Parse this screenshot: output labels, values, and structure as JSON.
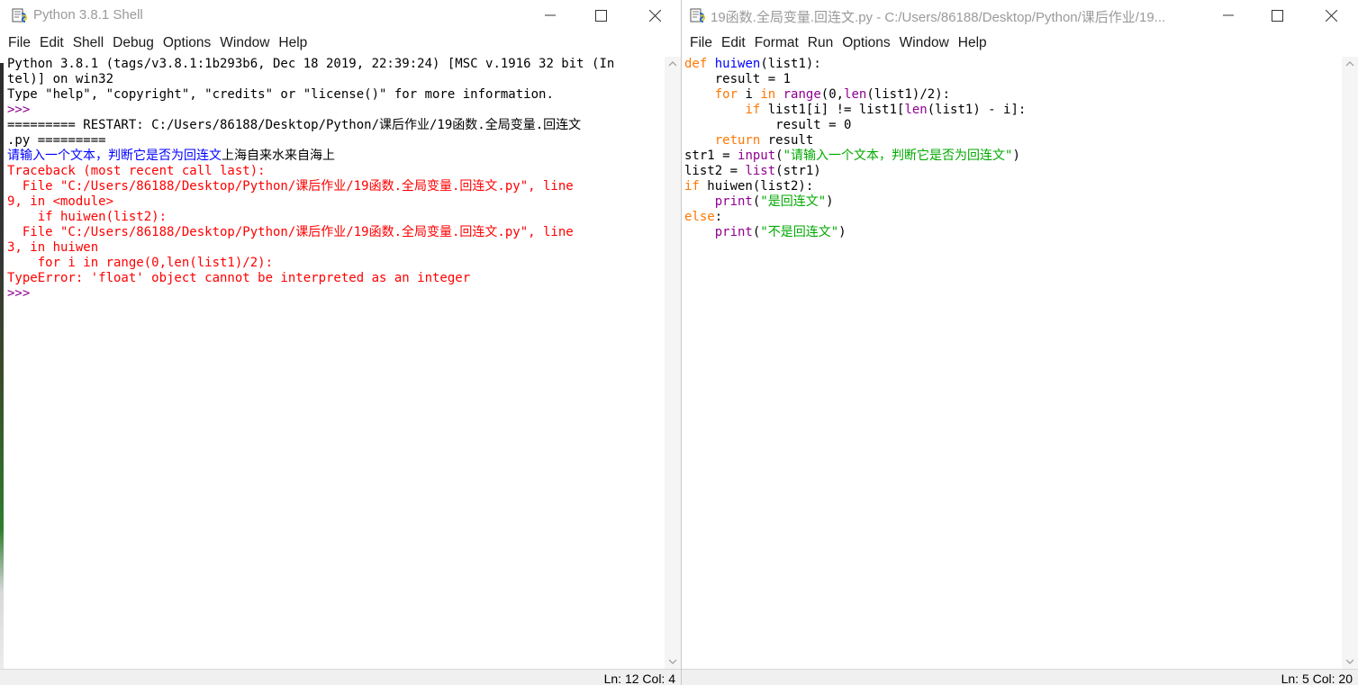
{
  "shell": {
    "title": "Python 3.8.1 Shell",
    "menu": [
      "File",
      "Edit",
      "Shell",
      "Debug",
      "Options",
      "Window",
      "Help"
    ],
    "lines": [
      {
        "segments": [
          {
            "text": "Python 3.8.1 (tags/v3.8.1:1b293b6, Dec 18 2019, 22:39:24) [MSC v.1916 32 bit (In",
            "color": "black"
          }
        ]
      },
      {
        "segments": [
          {
            "text": "tel)] on win32",
            "color": "black"
          }
        ]
      },
      {
        "segments": [
          {
            "text": "Type \"help\", \"copyright\", \"credits\" or \"license()\" for more information.",
            "color": "black"
          }
        ]
      },
      {
        "segments": [
          {
            "text": ">>> ",
            "color": "purple"
          }
        ]
      },
      {
        "segments": [
          {
            "text": "========= RESTART: C:/Users/86188/Desktop/Python/课后作业/19函数.全局变量.回连文",
            "color": "black"
          }
        ]
      },
      {
        "segments": [
          {
            "text": ".py =========",
            "color": "black"
          }
        ]
      },
      {
        "segments": [
          {
            "text": "请输入一个文本，判断它是否为回连文",
            "color": "blue"
          },
          {
            "text": "上海自来水来自海上",
            "color": "black"
          }
        ]
      },
      {
        "segments": [
          {
            "text": "Traceback (most recent call last):",
            "color": "red"
          }
        ]
      },
      {
        "segments": [
          {
            "text": "  File \"C:/Users/86188/Desktop/Python/课后作业/19函数.全局变量.回连文.py\", line",
            "color": "red"
          }
        ]
      },
      {
        "segments": [
          {
            "text": "9, in <module>",
            "color": "red"
          }
        ]
      },
      {
        "segments": [
          {
            "text": "    if huiwen(list2):",
            "color": "red"
          }
        ]
      },
      {
        "segments": [
          {
            "text": "  File \"C:/Users/86188/Desktop/Python/课后作业/19函数.全局变量.回连文.py\", line",
            "color": "red"
          }
        ]
      },
      {
        "segments": [
          {
            "text": "3, in huiwen",
            "color": "red"
          }
        ]
      },
      {
        "segments": [
          {
            "text": "    for i in range(0,len(list1)/2):",
            "color": "red"
          }
        ]
      },
      {
        "segments": [
          {
            "text": "TypeError: 'float' object cannot be interpreted as an integer",
            "color": "red"
          }
        ]
      },
      {
        "segments": [
          {
            "text": ">>> ",
            "color": "purple"
          }
        ]
      }
    ],
    "status": "Ln: 12  Col: 4"
  },
  "editor": {
    "title": "19函数.全局变量.回连文.py - C:/Users/86188/Desktop/Python/课后作业/19...",
    "menu": [
      "File",
      "Edit",
      "Format",
      "Run",
      "Options",
      "Window",
      "Help"
    ],
    "lines": [
      {
        "segments": [
          {
            "text": "def",
            "color": "orange"
          },
          {
            "text": " ",
            "color": "black"
          },
          {
            "text": "huiwen",
            "color": "blue"
          },
          {
            "text": "(list1):",
            "color": "black"
          }
        ]
      },
      {
        "segments": [
          {
            "text": "    result = 1",
            "color": "black"
          }
        ]
      },
      {
        "segments": [
          {
            "text": "    ",
            "color": "black"
          },
          {
            "text": "for",
            "color": "orange"
          },
          {
            "text": " i ",
            "color": "black"
          },
          {
            "text": "in",
            "color": "orange"
          },
          {
            "text": " ",
            "color": "black"
          },
          {
            "text": "range",
            "color": "purple"
          },
          {
            "text": "(0,",
            "color": "black"
          },
          {
            "text": "len",
            "color": "purple"
          },
          {
            "text": "(list1)/2):",
            "color": "black"
          }
        ]
      },
      {
        "segments": [
          {
            "text": "        ",
            "color": "black"
          },
          {
            "text": "if",
            "color": "orange"
          },
          {
            "text": " list1[i] != list1[",
            "color": "black"
          },
          {
            "text": "len",
            "color": "purple"
          },
          {
            "text": "(list1) - i]:",
            "color": "black"
          }
        ]
      },
      {
        "segments": [
          {
            "text": "            result = 0",
            "color": "black"
          }
        ]
      },
      {
        "segments": [
          {
            "text": "    ",
            "color": "black"
          },
          {
            "text": "return",
            "color": "orange"
          },
          {
            "text": " result",
            "color": "black"
          }
        ]
      },
      {
        "segments": [
          {
            "text": "str1 = ",
            "color": "black"
          },
          {
            "text": "input",
            "color": "purple"
          },
          {
            "text": "(",
            "color": "black"
          },
          {
            "text": "\"请输入一个文本，判断它是否为回连文\"",
            "color": "green"
          },
          {
            "text": ")",
            "color": "black"
          }
        ]
      },
      {
        "segments": [
          {
            "text": "list2 = ",
            "color": "black"
          },
          {
            "text": "list",
            "color": "purple"
          },
          {
            "text": "(str1)",
            "color": "black"
          }
        ]
      },
      {
        "segments": [
          {
            "text": "if",
            "color": "orange"
          },
          {
            "text": " huiwen(list2):",
            "color": "black"
          }
        ]
      },
      {
        "segments": [
          {
            "text": "    ",
            "color": "black"
          },
          {
            "text": "print",
            "color": "purple"
          },
          {
            "text": "(",
            "color": "black"
          },
          {
            "text": "\"是回连文\"",
            "color": "green"
          },
          {
            "text": ")",
            "color": "black"
          }
        ]
      },
      {
        "segments": [
          {
            "text": "else",
            "color": "orange"
          },
          {
            "text": ":",
            "color": "black"
          }
        ]
      },
      {
        "segments": [
          {
            "text": "    ",
            "color": "black"
          },
          {
            "text": "print",
            "color": "purple"
          },
          {
            "text": "(",
            "color": "black"
          },
          {
            "text": "\"不是回连文\"",
            "color": "green"
          },
          {
            "text": ")",
            "color": "black"
          }
        ]
      }
    ],
    "status": "Ln: 5  Col: 20"
  },
  "icons": {
    "app": "python-idle-icon",
    "minimize": "minimize-icon",
    "maximize": "maximize-icon",
    "close": "close-icon",
    "scroll_up": "chevron-up-icon",
    "scroll_down": "chevron-down-icon"
  },
  "colors": {
    "keyword": "#ff7700",
    "builtin": "#900090",
    "string": "#00aa00",
    "definition": "#0000ff",
    "error": "#ff0000",
    "stdout": "#0000ff"
  }
}
